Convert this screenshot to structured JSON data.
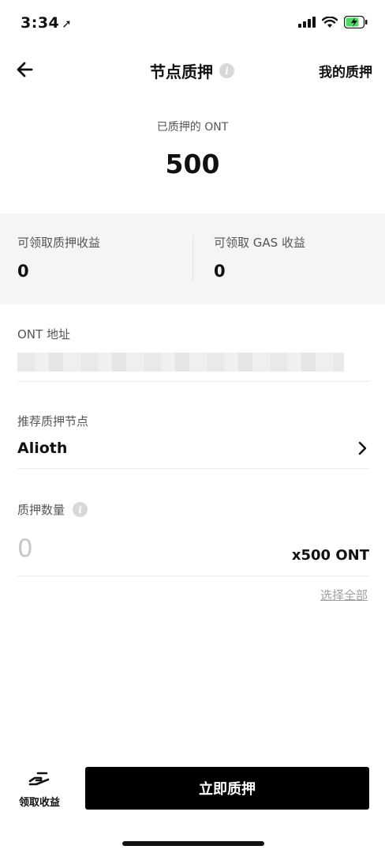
{
  "status_bar": {
    "time": "3:34",
    "location_icon": "location-arrow-icon",
    "signal_icon": "cellular-signal-icon",
    "wifi_icon": "wifi-icon",
    "battery_icon": "battery-charging-icon",
    "battery_color": "#4cd964"
  },
  "nav": {
    "back_icon": "arrow-left-icon",
    "title": "节点质押",
    "info_icon": "info-icon",
    "my_stake_label": "我的质押"
  },
  "summary": {
    "staked_label": "已质押的 ONT",
    "staked_value": "500"
  },
  "rewards": {
    "stake_reward_label": "可领取质押收益",
    "stake_reward_value": "0",
    "gas_reward_label": "可领取 GAS 收益",
    "gas_reward_value": "0"
  },
  "address": {
    "label": "ONT 地址"
  },
  "node": {
    "label": "推荐质押节点",
    "value": "Alioth"
  },
  "amount": {
    "label": "质押数量",
    "placeholder": "0",
    "balance": "x500 ONT",
    "select_all": "选择全部"
  },
  "bottom": {
    "claim_label": "领取收益",
    "claim_icon": "hand-coin-icon",
    "stake_button": "立即质押"
  }
}
